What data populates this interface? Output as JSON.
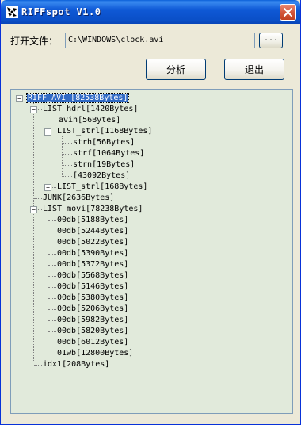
{
  "window": {
    "title": "RIFFspot V1.0"
  },
  "toolbar": {
    "open_label": "打开文件：",
    "path_value": "C:\\WINDOWS\\clock.avi",
    "browse_label": "...",
    "analyze_label": "分析",
    "exit_label": "退出"
  },
  "tree": {
    "nodes": [
      "RIFF_AVI [82538Bytes]",
      "LIST_hdrl[1420Bytes]",
      "avih[56Bytes]",
      "LIST_strl[1168Bytes]",
      "strh[56Bytes]",
      "strf[1064Bytes]",
      "strn[19Bytes]",
      "[43092Bytes]",
      "LIST_strl[168Bytes]",
      "JUNK[2636Bytes]",
      "LIST_movi[78238Bytes]",
      "00db[5188Bytes]",
      "00db[5244Bytes]",
      "00db[5022Bytes]",
      "00db[5390Bytes]",
      "00db[5372Bytes]",
      "00db[5568Bytes]",
      "00db[5146Bytes]",
      "00db[5380Bytes]",
      "00db[5206Bytes]",
      "00db[5982Bytes]",
      "00db[5820Bytes]",
      "00db[6012Bytes]",
      "01wb[12800Bytes]",
      "idx1[208Bytes]"
    ],
    "expand_minus": "−",
    "expand_plus": "+"
  },
  "icons": {
    "app": "app-logo-icon",
    "close": "close-icon"
  },
  "colors": {
    "titlebar": "#0a4fc7",
    "close": "#d3573c",
    "tree_bg": "#e1eadb",
    "selection": "#316ac5"
  }
}
